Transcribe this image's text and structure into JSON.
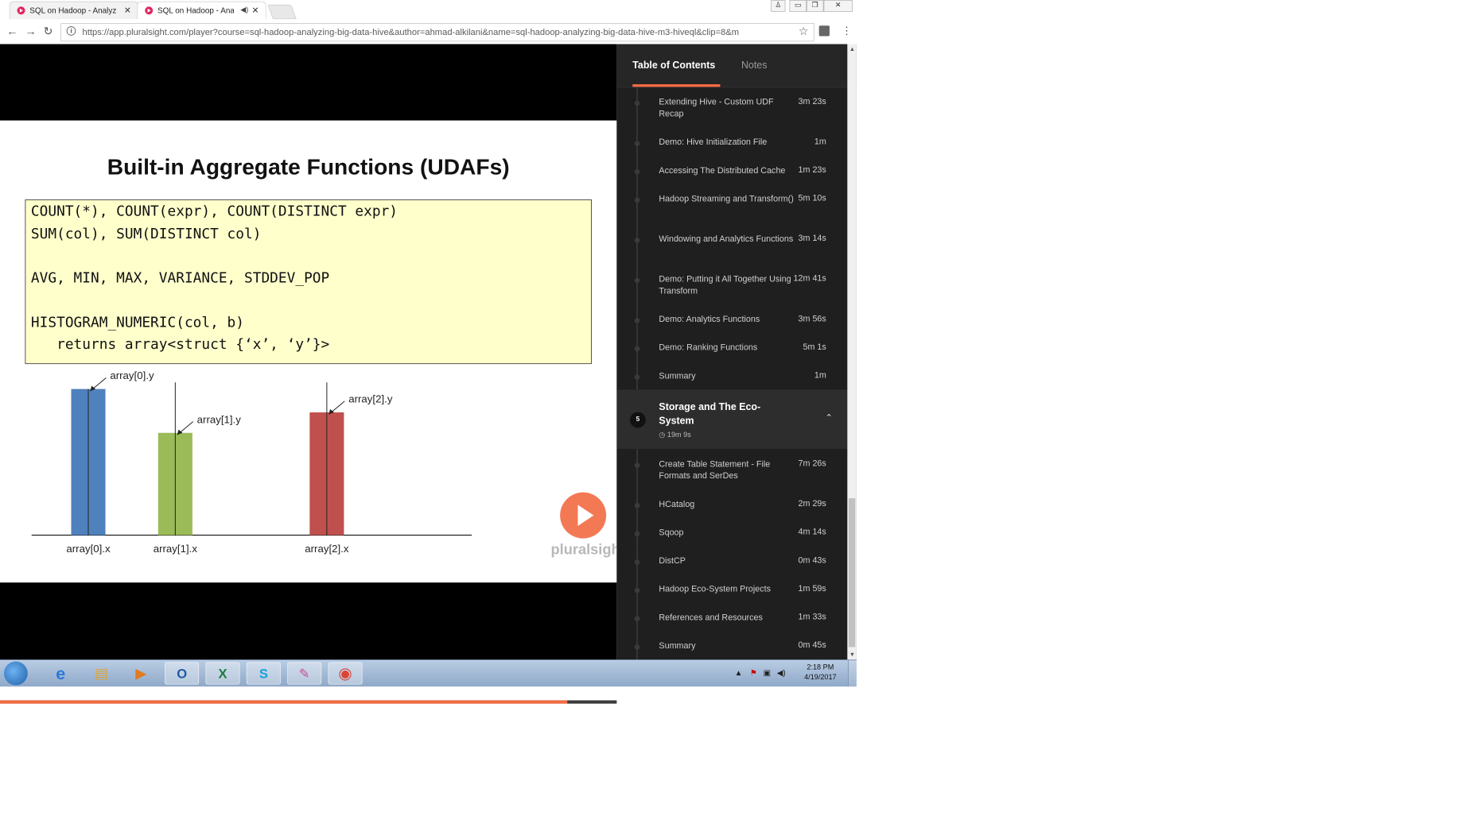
{
  "browser": {
    "tabs": [
      {
        "title": "SQL on Hadoop - Analyz",
        "active": false
      },
      {
        "title": "SQL on Hadoop - Ana",
        "active": true
      }
    ],
    "url": "https://app.pluralsight.com/player?course=sql-hadoop-analyzing-big-data-hive&author=ahmad-alkilani&name=sql-hadoop-analyzing-big-data-hive-m3-hiveql&clip=8&m"
  },
  "slide": {
    "title": "Built-in Aggregate Functions (UDAFs)",
    "code_lines": [
      "COUNT(*), COUNT(expr), COUNT(DISTINCT expr)",
      "SUM(col), SUM(DISTINCT col)",
      "",
      "AVG, MIN, MAX, VARIANCE, STDDEV_POP",
      "",
      "HISTOGRAM_NUMERIC(col, b)",
      "   returns array<struct {‘x’, ‘y’}>"
    ],
    "brand": "pluralsight"
  },
  "chart_data": {
    "type": "bar",
    "categories": [
      "array[0].x",
      "array[1].x",
      "array[2].x"
    ],
    "values": [
      100,
      70,
      84
    ],
    "annotations": [
      "array[0].y",
      "array[1].y",
      "array[2].y"
    ],
    "colors": [
      "#4f81bd",
      "#9bbb59",
      "#c0504d"
    ]
  },
  "sidebar": {
    "tabs": [
      {
        "label": "Table of Contents",
        "active": true
      },
      {
        "label": "Notes",
        "active": false
      }
    ],
    "clips_before": [
      {
        "name": "Extending Hive - Custom UDF Recap",
        "duration": "3m 23s"
      },
      {
        "name": "Demo: Hive Initialization File",
        "duration": "1m"
      },
      {
        "name": "Accessing The Distributed Cache",
        "duration": "1m 23s"
      },
      {
        "name": "Hadoop Streaming and Transform()",
        "duration": "5m 10s"
      },
      {
        "name": "Windowing and Analytics Functions",
        "duration": "3m 14s"
      },
      {
        "name": "Demo: Putting it All Together Using Transform",
        "duration": "12m 41s"
      },
      {
        "name": "Demo: Analytics Functions",
        "duration": "3m 56s"
      },
      {
        "name": "Demo: Ranking Functions",
        "duration": "5m 1s"
      },
      {
        "name": "Summary",
        "duration": "1m"
      }
    ],
    "module": {
      "number": "5",
      "title": "Storage and The Eco-System",
      "duration": "19m 9s"
    },
    "clips_after": [
      {
        "name": "Create Table Statement - File Formats and SerDes",
        "duration": "7m 26s"
      },
      {
        "name": "HCatalog",
        "duration": "2m 29s"
      },
      {
        "name": "Sqoop",
        "duration": "4m 14s"
      },
      {
        "name": "DistCP",
        "duration": "0m 43s"
      },
      {
        "name": "Hadoop Eco-System Projects",
        "duration": "1m 59s"
      },
      {
        "name": "References and Resources",
        "duration": "1m 33s"
      },
      {
        "name": "Summary",
        "duration": "0m 45s"
      }
    ]
  },
  "player": {
    "progress": 0.92
  },
  "taskbar": {
    "time": "2:18 PM",
    "date": "4/19/2017",
    "apps": [
      "internet-explorer",
      "file-explorer",
      "media-player",
      "outlook",
      "excel",
      "skype",
      "paint",
      "chrome"
    ]
  },
  "colors": {
    "accent": "#f26b43",
    "sidebar_bg": "#1f1f1f"
  }
}
